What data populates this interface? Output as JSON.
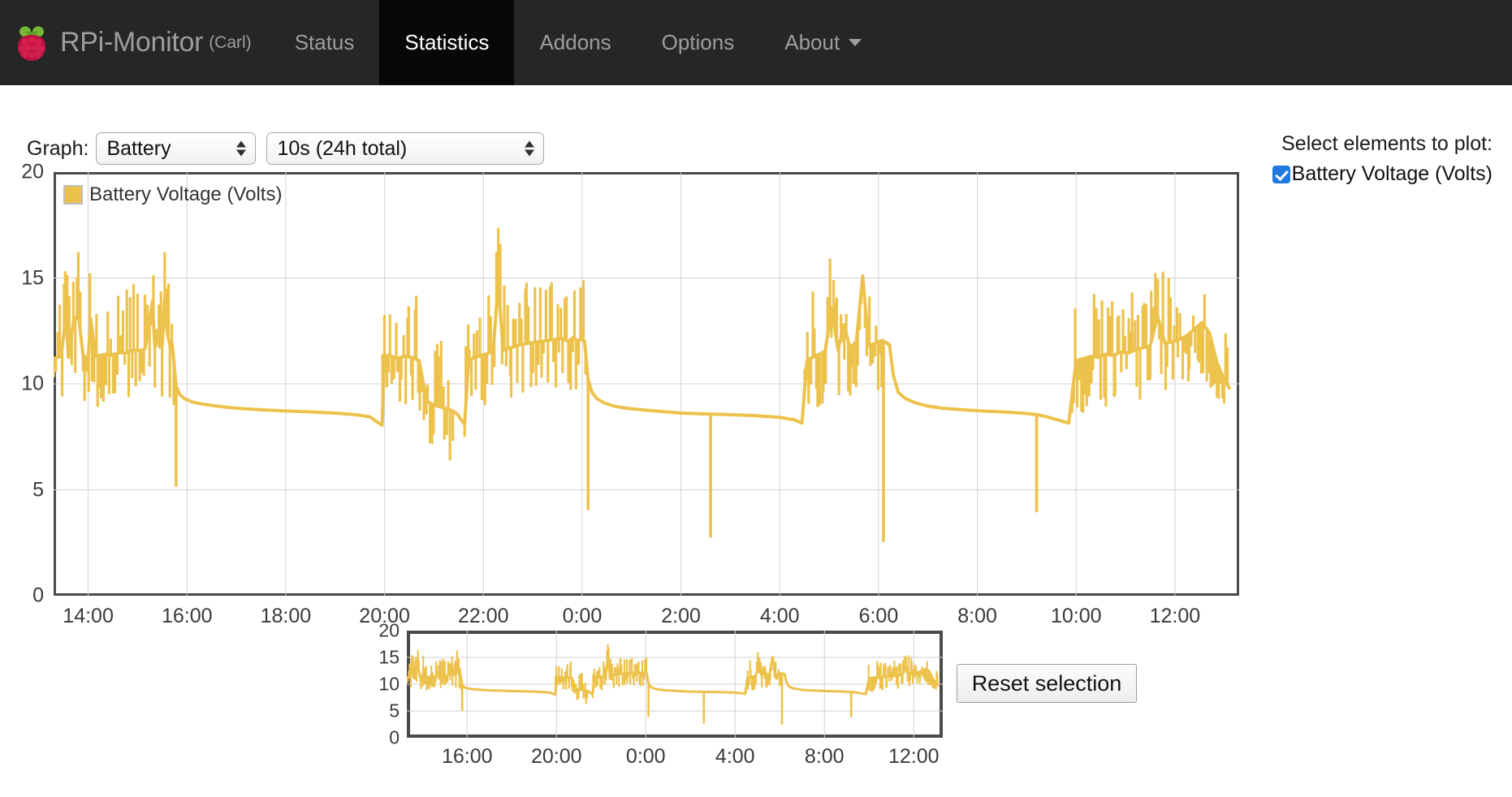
{
  "navbar": {
    "brand": "RPi-Monitor",
    "brand_suffix": "(Carl)",
    "logo_icon": "raspberry-pi-logo",
    "tabs": [
      {
        "label": "Status",
        "active": false,
        "dropdown": false
      },
      {
        "label": "Statistics",
        "active": true,
        "dropdown": false
      },
      {
        "label": "Addons",
        "active": false,
        "dropdown": false
      },
      {
        "label": "Options",
        "active": false,
        "dropdown": false
      },
      {
        "label": "About",
        "active": false,
        "dropdown": true
      }
    ],
    "caret_icon": "chevron-down-icon",
    "bg_color": "#262626",
    "active_bg_color": "#080808",
    "text_color": "#9d9d9d",
    "active_text_color": "#ffffff"
  },
  "controls": {
    "graph_label": "Graph:",
    "graph_select": {
      "value": "Battery",
      "options": [
        "Battery"
      ],
      "spinner_icon": "up-down-spinner-icon"
    },
    "period_select": {
      "value": "10s (24h total)",
      "options": [
        "10s (24h total)"
      ],
      "spinner_icon": "up-down-spinner-icon"
    }
  },
  "plot_select": {
    "title": "Select elements to plot:",
    "items": [
      {
        "label": "Battery Voltage (Volts)",
        "checked": true,
        "color": "#1f7ae0"
      }
    ]
  },
  "reset_button": {
    "label": "Reset selection"
  },
  "chart_data": {
    "type": "line",
    "title": "",
    "xlabel": "",
    "ylabel": "",
    "series_color": "#edc24c",
    "legend": [
      "Battery Voltage (Volts)"
    ],
    "legend_position": "top-left-inside",
    "grid": true,
    "ylim": [
      0,
      20
    ],
    "yticks": [
      0,
      5,
      10,
      15,
      20
    ],
    "ytick_labels": [
      "0",
      "5",
      "10",
      "15",
      "20"
    ],
    "xticks": [
      "14:00",
      "16:00",
      "18:00",
      "20:00",
      "22:00",
      "0:00",
      "2:00",
      "4:00",
      "6:00",
      "8:00",
      "10:00",
      "12:00"
    ],
    "x_start_hour": 13.3,
    "x_end_hour": 37.3,
    "units": "Volts",
    "series": [
      {
        "name": "Battery Voltage (Volts)",
        "x": [
          13.3,
          13.45,
          13.55,
          13.6,
          13.7,
          13.8,
          13.9,
          14.0,
          14.05,
          14.15,
          14.25,
          14.35,
          14.45,
          14.55,
          14.65,
          14.75,
          14.85,
          14.95,
          15.05,
          15.15,
          15.25,
          15.3,
          15.35,
          15.4,
          15.45,
          15.5,
          15.55,
          15.6,
          15.65,
          15.7,
          15.78,
          15.85,
          15.95,
          16.1,
          16.3,
          16.6,
          17.0,
          17.5,
          18.0,
          18.5,
          19.0,
          19.4,
          19.7,
          19.85,
          19.95,
          20.0,
          20.1,
          20.25,
          20.4,
          20.55,
          20.7,
          20.85,
          21.0,
          21.15,
          21.3,
          21.4,
          21.48,
          21.55,
          21.62,
          21.7,
          21.8,
          21.9,
          22.0,
          22.1,
          22.2,
          22.3,
          22.4,
          22.5,
          22.62,
          22.75,
          22.88,
          23.0,
          23.15,
          23.3,
          23.45,
          23.6,
          23.72,
          23.82,
          23.9,
          23.98,
          24.05,
          24.12,
          24.2,
          24.3,
          24.45,
          24.65,
          24.9,
          25.2,
          25.6,
          26.0,
          26.5,
          27.0,
          27.5,
          28.0,
          28.3,
          28.45,
          28.55,
          28.62,
          28.7,
          28.8,
          28.92,
          29.05,
          29.18,
          29.3,
          29.42,
          29.55,
          29.68,
          29.8,
          29.92,
          30.0,
          30.08,
          30.15,
          30.22,
          30.3,
          30.4,
          30.55,
          30.75,
          31.0,
          31.3,
          31.7,
          32.1,
          32.5,
          32.9,
          33.2,
          33.4,
          33.55,
          33.7,
          33.85,
          34.0,
          34.15,
          34.3,
          34.45,
          34.6,
          34.75,
          34.9,
          35.05,
          35.2,
          35.35,
          35.5,
          35.65,
          35.8,
          35.95,
          36.1,
          36.25,
          36.4,
          36.55,
          36.7,
          36.85,
          37.0,
          37.1,
          37.2,
          37.3
        ],
        "y": [
          11.2,
          11.3,
          13.2,
          11.25,
          12.9,
          13.3,
          11.3,
          11.25,
          13.1,
          11.3,
          11.35,
          11.4,
          11.35,
          11.42,
          11.48,
          11.45,
          11.55,
          11.6,
          11.58,
          11.65,
          13.0,
          13.9,
          11.7,
          12.2,
          11.75,
          11.8,
          14.0,
          12.4,
          11.85,
          11.9,
          9.9,
          9.5,
          9.3,
          9.15,
          9.05,
          8.95,
          8.85,
          8.78,
          8.72,
          8.68,
          8.62,
          8.55,
          8.45,
          8.2,
          8.05,
          11.3,
          11.35,
          11.2,
          11.3,
          11.25,
          11.1,
          9.2,
          9.0,
          8.9,
          8.8,
          8.7,
          8.55,
          8.3,
          8.1,
          11.0,
          11.25,
          11.3,
          11.38,
          11.45,
          11.55,
          14.8,
          11.6,
          11.68,
          11.75,
          11.85,
          11.9,
          11.95,
          12.0,
          12.05,
          12.1,
          12.15,
          12.0,
          12.2,
          12.05,
          12.1,
          12.0,
          10.2,
          9.6,
          9.3,
          9.1,
          8.95,
          8.85,
          8.78,
          8.7,
          8.62,
          8.58,
          8.55,
          8.5,
          8.42,
          8.3,
          8.15,
          11.1,
          11.2,
          11.3,
          11.4,
          11.55,
          13.6,
          11.6,
          12.8,
          11.7,
          12.0,
          15.1,
          11.8,
          11.9,
          12.0,
          12.05,
          11.95,
          11.85,
          10.4,
          9.6,
          9.3,
          9.1,
          8.95,
          8.85,
          8.78,
          8.72,
          8.68,
          8.62,
          8.55,
          8.45,
          8.35,
          8.25,
          8.15,
          11.1,
          11.2,
          11.3,
          11.25,
          11.4,
          11.35,
          11.5,
          11.45,
          11.6,
          11.7,
          11.8,
          13.2,
          11.9,
          12.0,
          12.1,
          12.3,
          12.6,
          12.9,
          12.4,
          11.0,
          10.2,
          9.8
        ],
        "dropouts": [
          {
            "x": 15.78,
            "y": 5.2
          },
          {
            "x": 24.12,
            "y": 4.1
          },
          {
            "x": 26.6,
            "y": 2.8
          },
          {
            "x": 30.1,
            "y": 2.6
          },
          {
            "x": 33.2,
            "y": 4.0
          }
        ]
      }
    ]
  },
  "mini_chart_data": {
    "type": "line",
    "series_color": "#edc24c",
    "ylim": [
      0,
      20
    ],
    "yticks": [
      0,
      5,
      10,
      15,
      20
    ],
    "ytick_labels": [
      "0",
      "5",
      "10",
      "15",
      "20"
    ],
    "xticks": [
      "16:00",
      "20:00",
      "0:00",
      "4:00",
      "8:00",
      "12:00"
    ],
    "x_start_hour": 13.3,
    "x_end_hour": 37.3,
    "grid": true,
    "selection": "full"
  }
}
